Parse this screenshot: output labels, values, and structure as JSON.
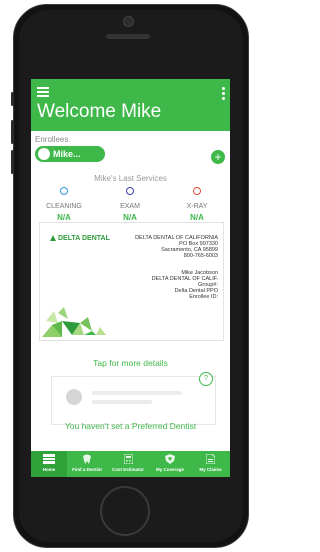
{
  "header": {
    "title": "Welcome Mike"
  },
  "enrollees": {
    "label": "Enrollees",
    "selected": "Mike..."
  },
  "services": {
    "title": "Mike's Last Services",
    "items": [
      {
        "label": "CLEANING",
        "value": "N/A",
        "color": "#2e9be0"
      },
      {
        "label": "EXAM",
        "value": "N/A",
        "color": "#3b3fb5"
      },
      {
        "label": "X-RAY",
        "value": "N/A",
        "color": "#e2503a"
      }
    ]
  },
  "card": {
    "logo": "DELTA DENTAL",
    "address": [
      "DELTA DENTAL OF CALIFORNIA",
      "PO Box 997330",
      "Sacramento, CA 95899",
      "800-765-6003"
    ],
    "member": [
      "Mike Jacobson",
      "DELTA DENTAL OF CALIF.",
      "Group#:",
      "Delta Dental PPO",
      "Enrollee ID:"
    ]
  },
  "tap_text": "Tap for more details",
  "dentist": {
    "help": "?",
    "message": "You haven't set a Preferred Dentist"
  },
  "tabs": [
    {
      "label": "Home",
      "icon": "card-icon"
    },
    {
      "label": "Find a Dentist",
      "icon": "tooth-icon"
    },
    {
      "label": "Cost Estimator",
      "icon": "calculator-icon"
    },
    {
      "label": "My Coverage",
      "icon": "shield-icon"
    },
    {
      "label": "My Claims",
      "icon": "document-icon"
    }
  ],
  "colors": {
    "brand": "#3fb84a",
    "tab_active": "#2fa23a"
  }
}
